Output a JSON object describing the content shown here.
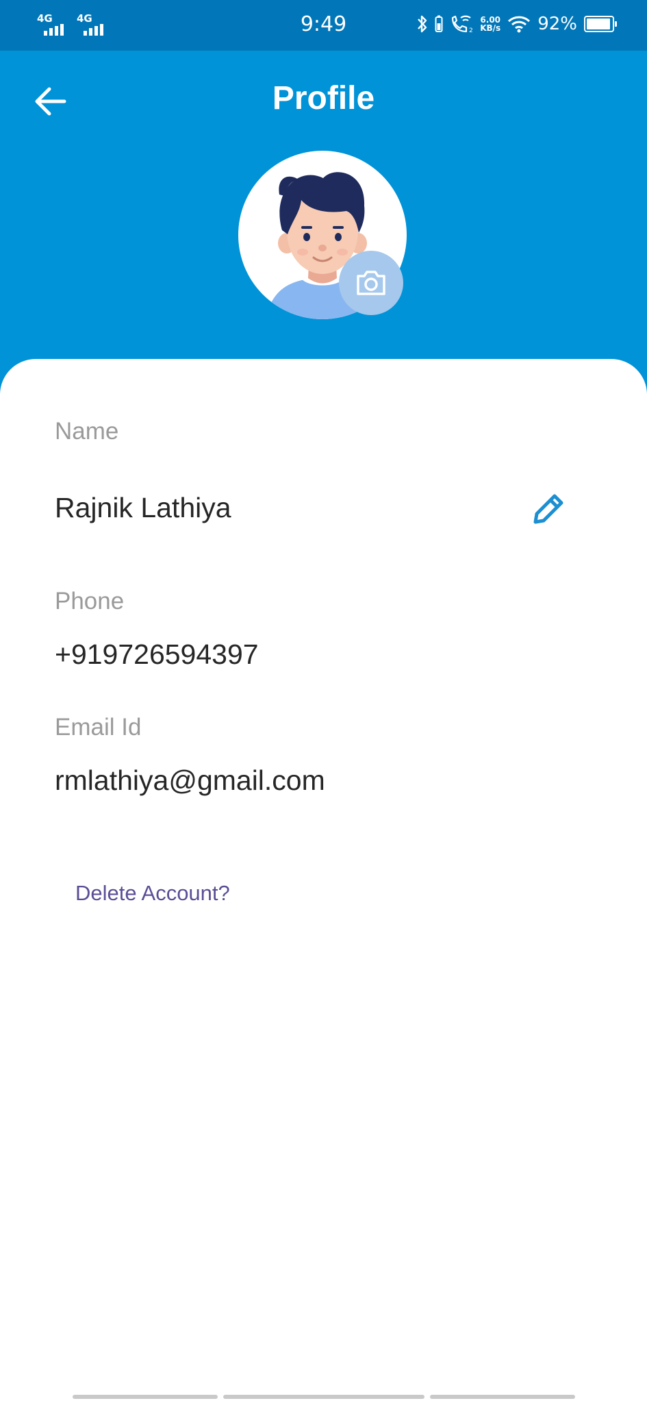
{
  "status_bar": {
    "sim1": "4G",
    "sim2": "4G",
    "time": "9:49",
    "speed_value": "6.00",
    "speed_unit": "KB/s",
    "battery": "92%"
  },
  "header": {
    "title": "Profile",
    "back_icon": "arrow-left-icon",
    "camera_icon": "camera-icon"
  },
  "profile": {
    "name_label": "Name",
    "name_value": "Rajnik Lathiya",
    "phone_label": "Phone",
    "phone_value": "+919726594397",
    "email_label": "Email Id",
    "email_value": "rmlathiya@gmail.com",
    "edit_icon": "pencil-icon"
  },
  "delete_account": "Delete Account?",
  "colors": {
    "status_bar": "#0177b9",
    "header": "#0093d7",
    "accent": "#1b8fd2",
    "delete_link": "#5b4e96"
  }
}
